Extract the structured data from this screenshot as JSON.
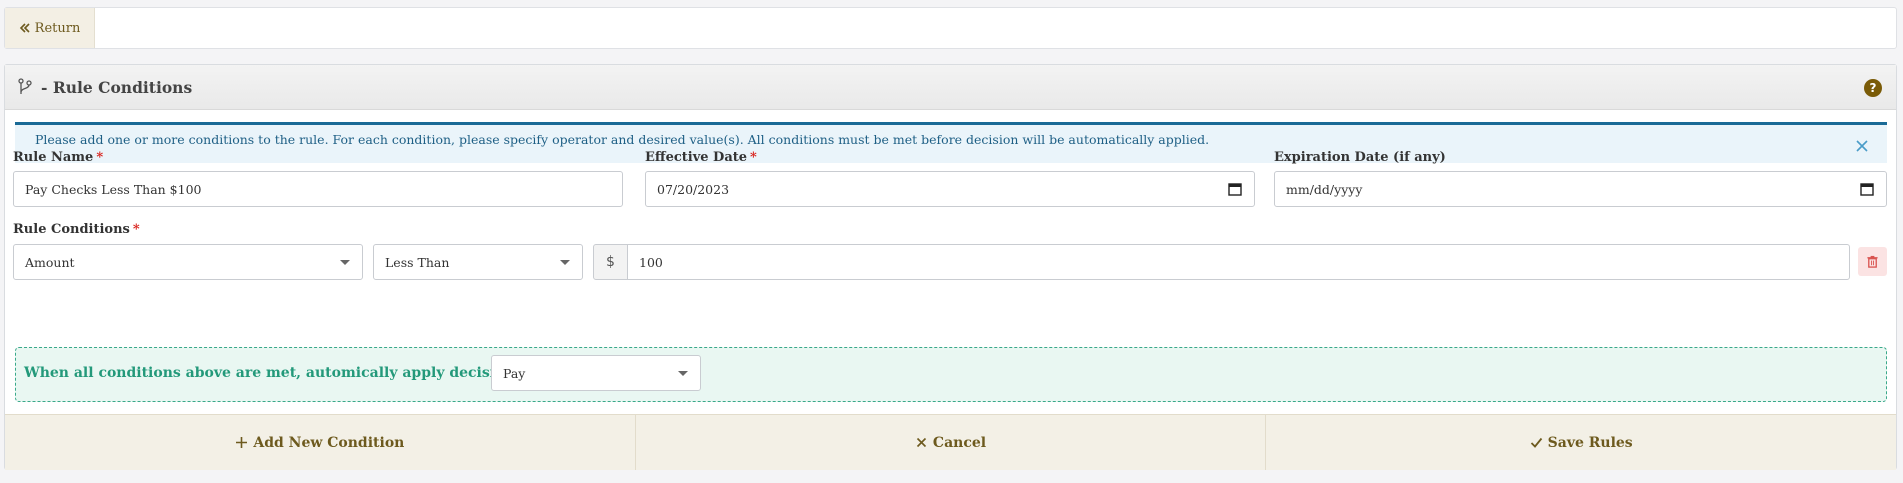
{
  "topbar": {
    "return_label": "Return"
  },
  "panel": {
    "title": "- Rule Conditions",
    "help_glyph": "?",
    "alert_text": "Please add one or more conditions to the rule. For each condition, please specify operator and desired value(s). All conditions must be met before decision will be automatically applied."
  },
  "form": {
    "rule_name": {
      "label": "Rule Name",
      "required_mark": "*",
      "value": "Pay Checks Less Than $100"
    },
    "effective_date": {
      "label": "Effective Date",
      "required_mark": "*",
      "value": "07/20/2023"
    },
    "expiration_date": {
      "label": "Expiration Date (if any)",
      "value": "mm/dd/yyyy"
    },
    "conditions": {
      "label": "Rule Conditions",
      "required_mark": "*",
      "field": "Amount",
      "operator": "Less Than",
      "currency_symbol": "$",
      "value": "100"
    },
    "decision": {
      "label": "When all conditions above are met, automically apply decision:",
      "value": "Pay"
    }
  },
  "footer": {
    "add_label": "Add New Condition",
    "cancel_label": "Cancel",
    "save_label": "Save Rules"
  },
  "colors": {
    "accent_brown": "#6d5a1e",
    "alert_blue": "#1e5f85",
    "success_green": "#23997a",
    "required_red": "#d9231d"
  }
}
